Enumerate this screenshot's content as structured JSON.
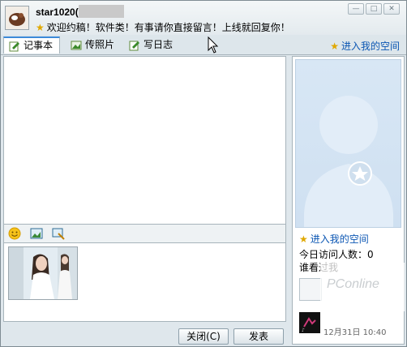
{
  "titlebar": {
    "username": "star1020(",
    "status_message": "欢迎约稿！软件类！有事请你直接留言！上线就回复你！",
    "window_buttons": [
      "minimize-icon",
      "maximize-icon",
      "close-icon"
    ]
  },
  "tabs": [
    {
      "label": "记事本",
      "icon": "notepad-icon",
      "active": true
    },
    {
      "label": "传照片",
      "icon": "photo-icon",
      "active": false
    },
    {
      "label": "写日志",
      "icon": "diary-icon",
      "active": false
    }
  ],
  "header_link": "进入我的空间",
  "toolbar": {
    "icons": [
      "emoticon-icon",
      "image-icon",
      "screenshot-icon"
    ]
  },
  "buttons": {
    "close": "关闭(C)",
    "send": "发表"
  },
  "sidebar": {
    "zone_link": "进入我的空间",
    "visits_label": "今日访问人数：0",
    "visitors_title": "谁看过我",
    "visit_time": "12月31日 10:40"
  },
  "watermark": "PConline",
  "colors": {
    "accent": "#3c8ad9",
    "link": "#0b56b3",
    "star": "#e0a800",
    "frame": "#dfe7ec"
  }
}
